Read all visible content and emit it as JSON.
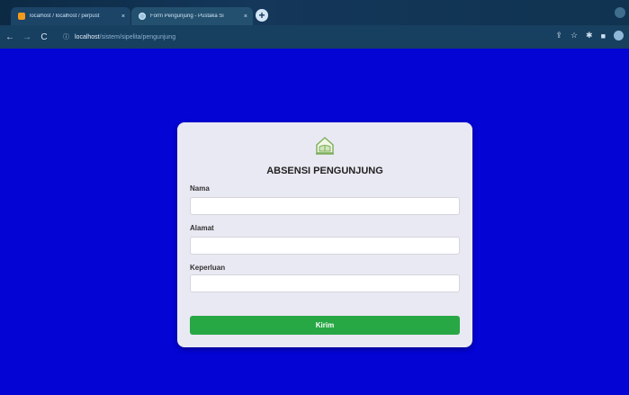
{
  "browser": {
    "tabs": [
      {
        "label": "localhost / localhost / perpust",
        "favicon": "phpmyadmin-icon"
      },
      {
        "label": "Form Pengunjung - Pustaka Si",
        "favicon": "globe-icon"
      }
    ],
    "close_symbol": "×",
    "new_tab_symbol": "+",
    "url_host": "localhost",
    "url_path": "/sistem/sipelita/pengunjung"
  },
  "form": {
    "logo": "library-home-icon",
    "title": "ABSENSI PENGUNJUNG",
    "fields": [
      {
        "label": "Nama",
        "value": ""
      },
      {
        "label": "Alamat",
        "value": ""
      },
      {
        "label": "Keperluan",
        "value": ""
      }
    ],
    "submit_label": "Kirim"
  },
  "colors": {
    "page_background": "#0404d4",
    "card_background": "#e9e9f3",
    "submit_button": "#28a745"
  }
}
